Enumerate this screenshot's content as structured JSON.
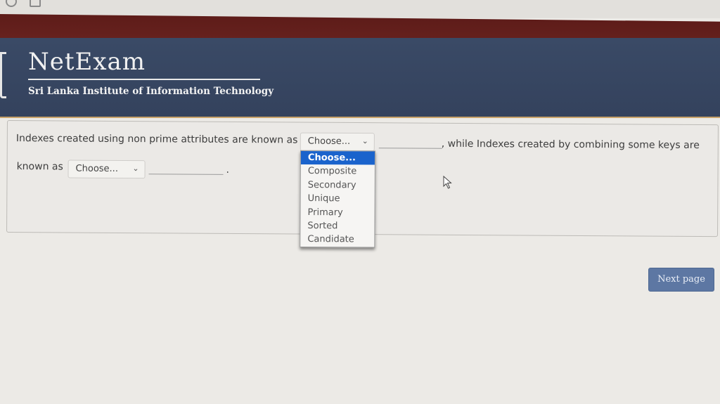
{
  "header": {
    "logo": "NetExam",
    "institute": "Sri Lanka Institute of Information Technology"
  },
  "question": {
    "part1": "Indexes created using non prime attributes are known as",
    "part2": ", while Indexes created by combining some keys are",
    "part3": "known as",
    "part4": "."
  },
  "select1": {
    "value": "Choose..."
  },
  "select2": {
    "value": "Choose..."
  },
  "dropdown": {
    "options": [
      "Choose...",
      "Composite",
      "Secondary",
      "Unique",
      "Primary",
      "Sorted",
      "Candidate"
    ],
    "selected_index": 0
  },
  "next_button": {
    "label": "Next page"
  },
  "colors": {
    "header_bg": "#3a4a66",
    "maroon_bar": "#5e1c19",
    "highlight": "#1a63cc",
    "button": "#5d77a3"
  },
  "icons": [
    "chevron-down-icon",
    "mouse-cursor-icon",
    "circle-icon",
    "square-icon"
  ]
}
